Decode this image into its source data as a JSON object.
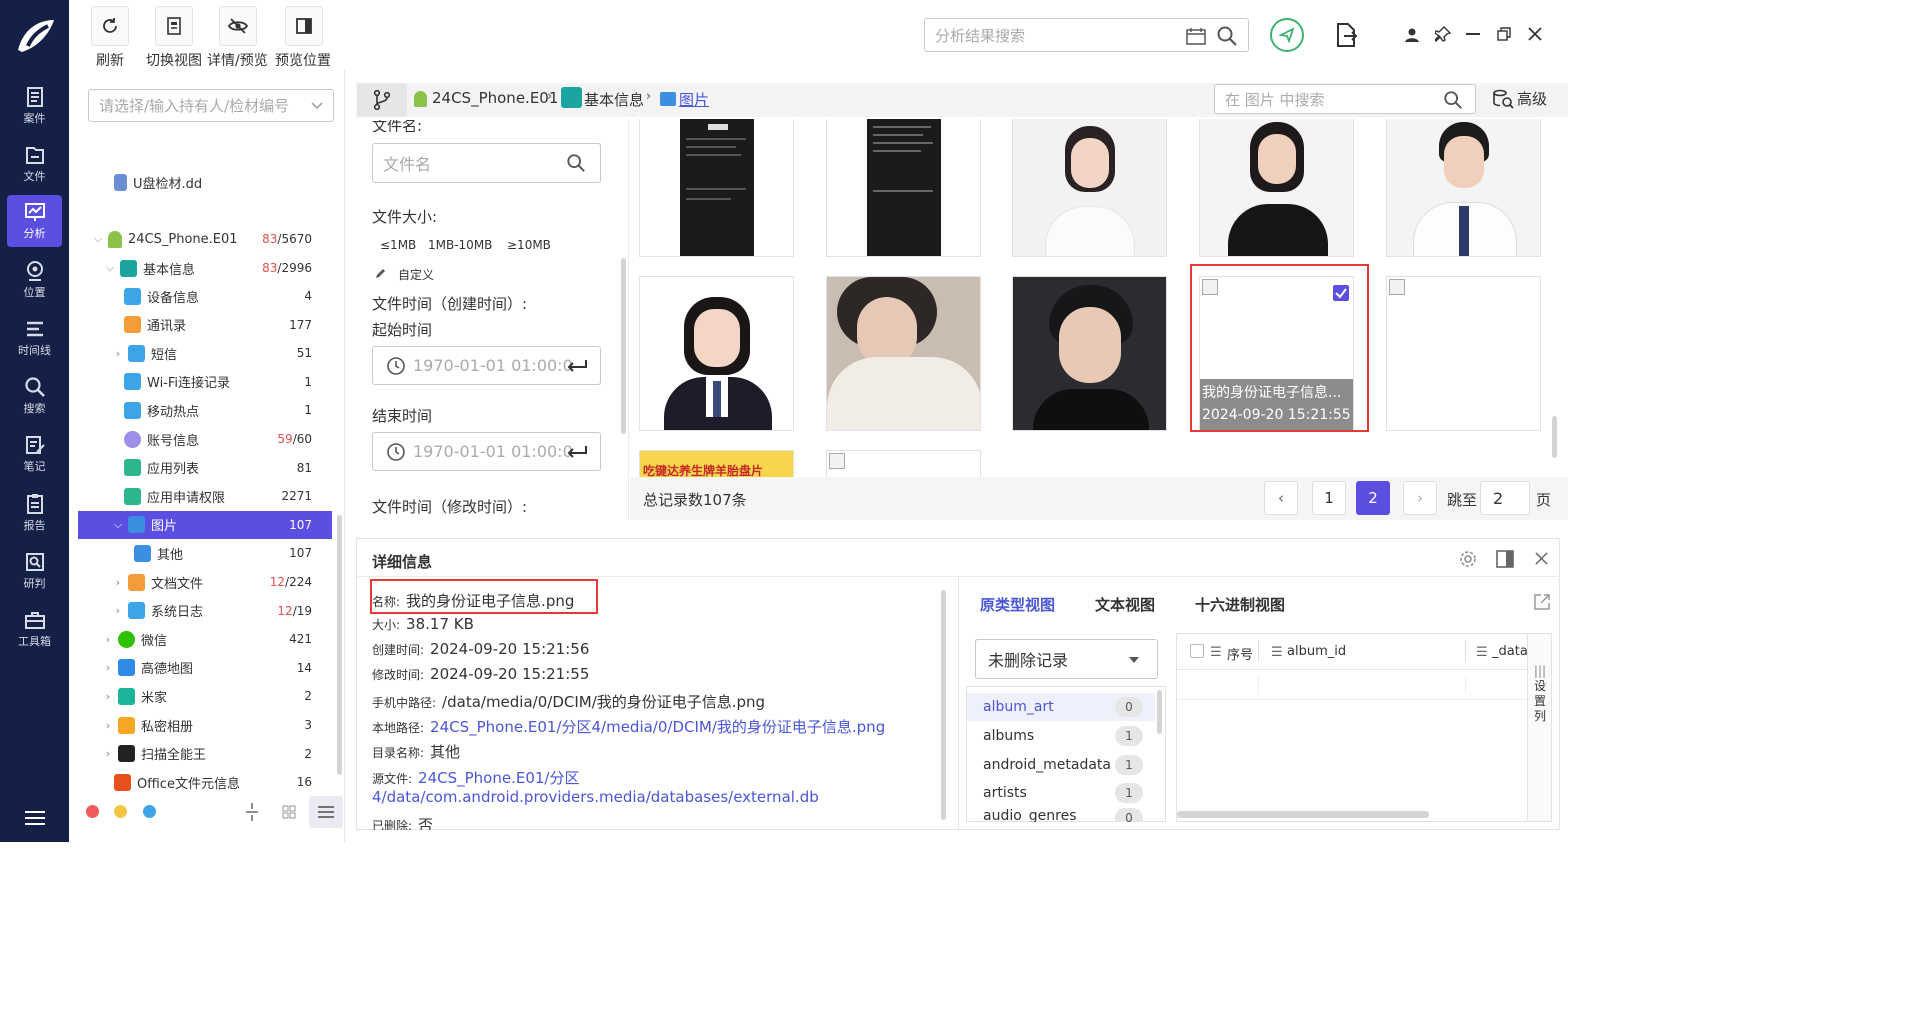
{
  "nav": {
    "items": [
      {
        "label": "案件",
        "icon": "case-icon"
      },
      {
        "label": "文件",
        "icon": "folder-icon"
      },
      {
        "label": "分析",
        "icon": "analysis-icon"
      },
      {
        "label": "位置",
        "icon": "location-icon"
      },
      {
        "label": "时间线",
        "icon": "timeline-icon"
      },
      {
        "label": "搜索",
        "icon": "search-icon"
      },
      {
        "label": "笔记",
        "icon": "note-icon"
      },
      {
        "label": "报告",
        "icon": "report-icon"
      },
      {
        "label": "研判",
        "icon": "judge-icon"
      },
      {
        "label": "工具箱",
        "icon": "toolbox-icon"
      }
    ]
  },
  "toolbar": {
    "refresh": "刷新",
    "switch_view": "切换视图",
    "detail_preview": "详情/预览",
    "preview_position": "预览位置",
    "result_search_placeholder": "分析结果搜索"
  },
  "tree": {
    "select_placeholder": "请选择/输入持有人/检材编号",
    "usb": "U盘检材.dd",
    "device": {
      "label": "24CS_Phone.E01",
      "hit": "83",
      "total": "/5670"
    },
    "basic": {
      "label": "基本信息",
      "hit": "83",
      "total": "/2996"
    },
    "rows": [
      {
        "label": "设备信息",
        "count": "4"
      },
      {
        "label": "通讯录",
        "count": "177"
      },
      {
        "label": "短信",
        "count": "51"
      },
      {
        "label": "Wi-Fi连接记录",
        "count": "1"
      },
      {
        "label": "移动热点",
        "count": "1"
      },
      {
        "label": "账号信息",
        "hit": "59",
        "total": "/60"
      },
      {
        "label": "应用列表",
        "count": "81"
      },
      {
        "label": "应用申请权限",
        "count": "2271"
      },
      {
        "label": "图片",
        "count": "107"
      },
      {
        "label": "其他",
        "count": "107"
      },
      {
        "label": "文档文件",
        "hit": "12",
        "total": "/224"
      },
      {
        "label": "系统日志",
        "hit": "12",
        "total": "/19"
      },
      {
        "label": "微信",
        "count": "421"
      },
      {
        "label": "高德地图",
        "count": "14"
      },
      {
        "label": "米家",
        "count": "2"
      },
      {
        "label": "私密相册",
        "count": "3"
      },
      {
        "label": "扫描全能王",
        "count": "2"
      },
      {
        "label": "Office文件元信息",
        "count": "16"
      }
    ]
  },
  "crumb": {
    "device": "24CS_Phone.E01",
    "basic": "基本信息",
    "pictures": "图片",
    "search_placeholder": "在 图片 中搜索",
    "advanced": "高级"
  },
  "filter": {
    "file_name_label": "文件名:",
    "file_name_placeholder": "文件名",
    "file_size_label": "文件大小:",
    "size_opts": [
      "≤1MB",
      "1MB-10MB",
      "≥10MB"
    ],
    "custom": "自定义",
    "create_time_label": "文件时间（创建时间）:",
    "start_label": "起始时间",
    "start_value": "1970-01-01 01:00:0",
    "end_label": "结束时间",
    "end_value": "1970-01-01 01:00:0",
    "modify_time_label": "文件时间（修改时间）:"
  },
  "gallery": {
    "selected_name": "我的身份证电子信息...",
    "selected_time": "2024-09-20 15:21:55",
    "ad_text": "吃键达养生牌羊胎盘片"
  },
  "pager": {
    "total": "总记录数107条",
    "pages": [
      "1",
      "2"
    ],
    "jump_label": "跳至",
    "jump_value": "2",
    "page_suffix": "页"
  },
  "detail": {
    "title": "详细信息",
    "name_k": "名称:",
    "name_v": "我的身份证电子信息.png",
    "size_k": "大小:",
    "size_v": "38.17 KB",
    "ctime_k": "创建时间:",
    "ctime_v": "2024-09-20 15:21:56",
    "mtime_k": "修改时间:",
    "mtime_v": "2024-09-20 15:21:55",
    "phone_path_k": "手机中路径:",
    "phone_path_v": "/data/media/0/DCIM/我的身份证电子信息.png",
    "local_path_k": "本地路径:",
    "local_path_v": "24CS_Phone.E01/分区4/media/0/DCIM/我的身份证电子信息.png",
    "dir_k": "目录名称:",
    "dir_v": "其他",
    "src_k": "源文件:",
    "src_v1": "24CS_Phone.E01/分区",
    "src_v2": "4/data/com.android.providers.media/databases/external.db",
    "deleted_k": "已删除:",
    "deleted_v": "否"
  },
  "views": {
    "tabs": [
      "原类型视图",
      "文本视图",
      "十六进制视图"
    ],
    "record_select": "未删除记录",
    "tables": [
      {
        "name": "album_art",
        "n": "0"
      },
      {
        "name": "albums",
        "n": "1"
      },
      {
        "name": "android_metadata",
        "n": "1"
      },
      {
        "name": "artists",
        "n": "1"
      },
      {
        "name": "audio_genres",
        "n": "0"
      }
    ],
    "columns": [
      "序号",
      "album_id",
      "_data"
    ],
    "set_columns": "设置列"
  },
  "colors": {
    "nav_bg": "#152047",
    "accent": "#5a4fe0",
    "highlight_red": "#e53935",
    "link": "#4a56d8"
  }
}
